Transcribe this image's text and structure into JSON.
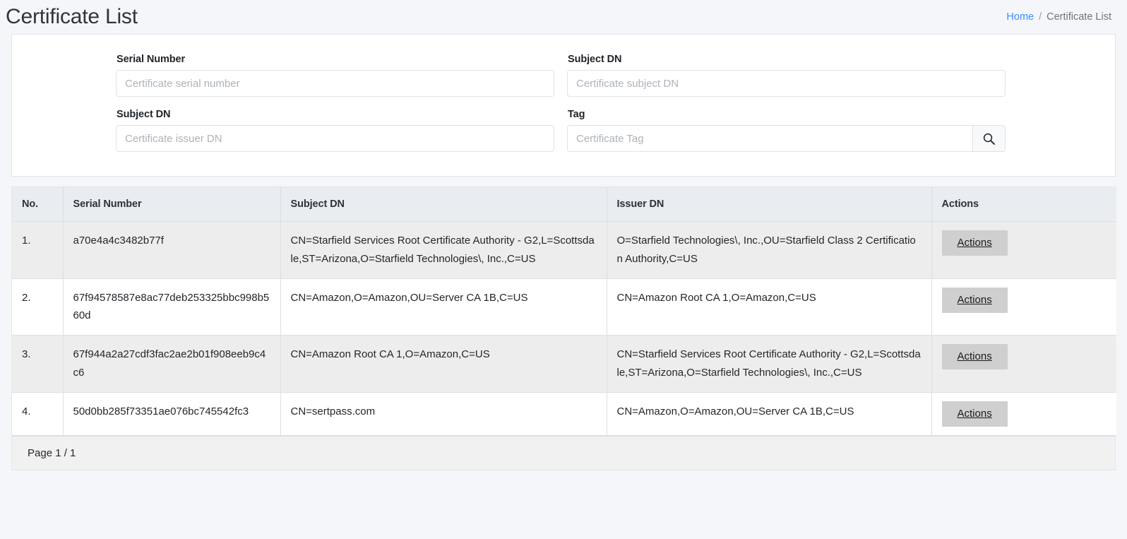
{
  "header": {
    "title": "Certificate List",
    "breadcrumb": {
      "home_label": "Home",
      "separator": "/",
      "current_label": "Certificate List"
    }
  },
  "search_form": {
    "fields": [
      {
        "label": "Serial Number",
        "placeholder": "Certificate serial number",
        "value": "",
        "name": "serial-number"
      },
      {
        "label": "Subject DN",
        "placeholder": "Certificate subject DN",
        "value": "",
        "name": "subject-dn"
      },
      {
        "label": "Subject DN",
        "placeholder": "Certificate issuer DN",
        "value": "",
        "name": "issuer-dn"
      },
      {
        "label": "Tag",
        "placeholder": "Certificate Tag",
        "value": "",
        "name": "tag"
      }
    ],
    "search_button": {
      "icon": "search-icon",
      "label": ""
    }
  },
  "table": {
    "columns": [
      "No.",
      "Serial Number",
      "Subject DN",
      "Issuer DN",
      "Actions"
    ],
    "action_label": "Actions",
    "rows": [
      {
        "no": "1.",
        "serial": "a70e4a4c3482b77f",
        "subject": "CN=Starfield Services Root Certificate Authority - G2,L=Scottsdale,ST=Arizona,O=Starfield Technologies\\, Inc.,C=US",
        "issuer": "O=Starfield Technologies\\, Inc.,OU=Starfield Class 2 Certification Authority,C=US"
      },
      {
        "no": "2.",
        "serial": "67f94578587e8ac77deb253325bbc998b560d",
        "subject": "CN=Amazon,O=Amazon,OU=Server CA 1B,C=US",
        "issuer": "CN=Amazon Root CA 1,O=Amazon,C=US"
      },
      {
        "no": "3.",
        "serial": "67f944a2a27cdf3fac2ae2b01f908eeb9c4c6",
        "subject": "CN=Amazon Root CA 1,O=Amazon,C=US",
        "issuer": "CN=Starfield Services Root Certificate Authority - G2,L=Scottsdale,ST=Arizona,O=Starfield Technologies\\, Inc.,C=US"
      },
      {
        "no": "4.",
        "serial": "50d0bb285f73351ae076bc745542fc3",
        "subject": "CN=sertpass.com",
        "issuer": "CN=Amazon,O=Amazon,OU=Server CA 1B,C=US"
      }
    ],
    "footer": {
      "pagination_text": "Page 1 / 1"
    }
  },
  "colors": {
    "page_background": "#f4f6f9",
    "card_background": "#ffffff",
    "link_blue": "#3c8dff",
    "table_header_bg": "#e9edf1",
    "row_stripe_bg": "#ededed",
    "action_button_bg": "#cfcfcf",
    "footer_bg": "#f1f1f1"
  }
}
